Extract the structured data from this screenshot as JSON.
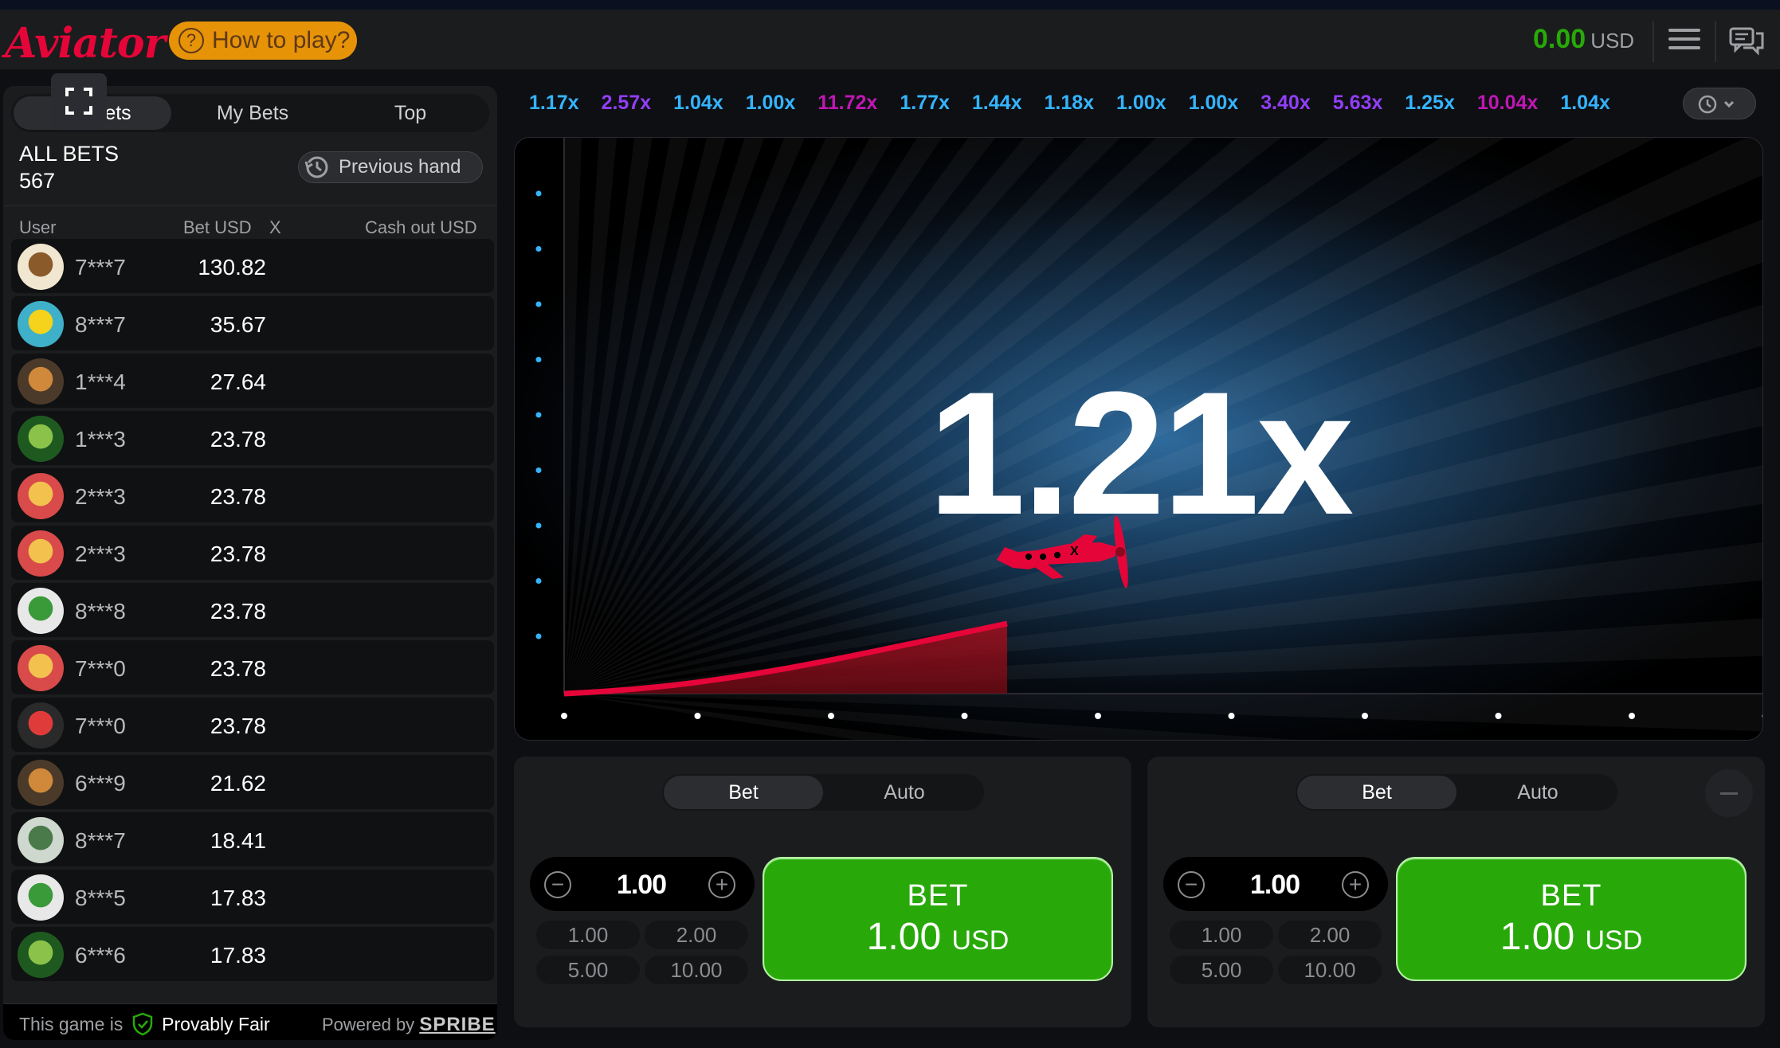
{
  "header": {
    "logo": "Aviator",
    "how_to_play": "How to play?",
    "balance_value": "0.00",
    "balance_currency": "USD"
  },
  "left_panel": {
    "tabs": [
      {
        "label": "All Bets",
        "visible_text": "ets"
      },
      {
        "label": "My Bets"
      },
      {
        "label": "Top"
      }
    ],
    "all_bets_title": "ALL BETS",
    "all_bets_count": "567",
    "previous_hand": "Previous hand",
    "columns": {
      "user": "User",
      "bet": "Bet USD",
      "x": "X",
      "cashout": "Cash out USD"
    },
    "rows": [
      {
        "user": "7***7",
        "bet": "130.82",
        "avatar": "dog"
      },
      {
        "user": "8***7",
        "bet": "35.67",
        "avatar": "letter-a"
      },
      {
        "user": "1***4",
        "bet": "27.64",
        "avatar": "tiger"
      },
      {
        "user": "1***3",
        "bet": "23.78",
        "avatar": "leaf"
      },
      {
        "user": "2***3",
        "bet": "23.78",
        "avatar": "lucky-cat"
      },
      {
        "user": "2***3",
        "bet": "23.78",
        "avatar": "lucky-cat"
      },
      {
        "user": "8***8",
        "bet": "23.78",
        "avatar": "clover"
      },
      {
        "user": "7***0",
        "bet": "23.78",
        "avatar": "lucky-cat"
      },
      {
        "user": "7***0",
        "bet": "23.78",
        "avatar": "red-mask"
      },
      {
        "user": "6***9",
        "bet": "21.62",
        "avatar": "tiger"
      },
      {
        "user": "8***7",
        "bet": "18.41",
        "avatar": "dollar"
      },
      {
        "user": "8***5",
        "bet": "17.83",
        "avatar": "clover"
      },
      {
        "user": "6***6",
        "bet": "17.83",
        "avatar": "leaf"
      }
    ],
    "footer": {
      "prefix": "This game is",
      "provably_fair": "Provably Fair",
      "powered_by": "Powered by",
      "brand": "SPRIBE"
    }
  },
  "history": [
    {
      "value": "1.17x",
      "color": "#34b4ff"
    },
    {
      "value": "2.57x",
      "color": "#913ef8"
    },
    {
      "value": "1.04x",
      "color": "#34b4ff"
    },
    {
      "value": "1.00x",
      "color": "#34b4ff"
    },
    {
      "value": "11.72x",
      "color": "#c017b4"
    },
    {
      "value": "1.77x",
      "color": "#34b4ff"
    },
    {
      "value": "1.44x",
      "color": "#34b4ff"
    },
    {
      "value": "1.18x",
      "color": "#34b4ff"
    },
    {
      "value": "1.00x",
      "color": "#34b4ff"
    },
    {
      "value": "1.00x",
      "color": "#34b4ff"
    },
    {
      "value": "3.40x",
      "color": "#913ef8"
    },
    {
      "value": "5.63x",
      "color": "#913ef8"
    },
    {
      "value": "1.25x",
      "color": "#34b4ff"
    },
    {
      "value": "10.04x",
      "color": "#c017b4"
    },
    {
      "value": "1.04x",
      "color": "#34b4ff"
    }
  ],
  "game": {
    "multiplier": "1.21x"
  },
  "bet_panels": [
    {
      "tabs": [
        "Bet",
        "Auto"
      ],
      "amount": "1.00",
      "quick": [
        "1.00",
        "2.00",
        "5.00",
        "10.00"
      ],
      "button_label": "BET",
      "button_amount": "1.00",
      "button_currency": "USD"
    },
    {
      "tabs": [
        "Bet",
        "Auto"
      ],
      "amount": "1.00",
      "quick": [
        "1.00",
        "2.00",
        "5.00",
        "10.00"
      ],
      "button_label": "BET",
      "button_amount": "1.00",
      "button_currency": "USD"
    }
  ],
  "colors": {
    "brand_red": "#e50539",
    "green": "#28a909",
    "orange": "#e69308"
  }
}
